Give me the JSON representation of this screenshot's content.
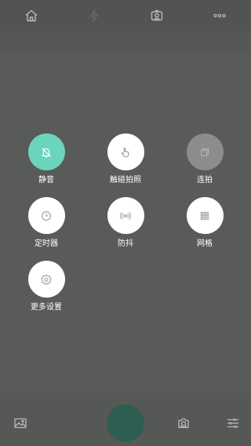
{
  "top_bar": {
    "icons": [
      "home-icon",
      "flash-icon",
      "face-camera-icon",
      "more-icon"
    ]
  },
  "menu": {
    "items": [
      {
        "label": "静音",
        "icon": "bell-off-icon",
        "state": "active"
      },
      {
        "label": "触碰拍照",
        "icon": "touch-icon",
        "state": "normal"
      },
      {
        "label": "连拍",
        "icon": "burst-icon",
        "state": "disabled"
      },
      {
        "label": "定时器",
        "icon": "clock-icon",
        "state": "normal"
      },
      {
        "label": "防抖",
        "icon": "stabilizer-icon",
        "state": "normal"
      },
      {
        "label": "网格",
        "icon": "grid-icon",
        "state": "normal"
      },
      {
        "label": "更多设置",
        "icon": "gear-icon",
        "state": "normal"
      }
    ]
  },
  "bottom_bar": {
    "icons": [
      "gallery-icon",
      "shutter-button",
      "switch-camera-icon",
      "settings-sliders-icon"
    ]
  },
  "colors": {
    "active": "#6bd4bd",
    "disabled": "#8b8c8b",
    "shutter": "#2e5e52"
  }
}
